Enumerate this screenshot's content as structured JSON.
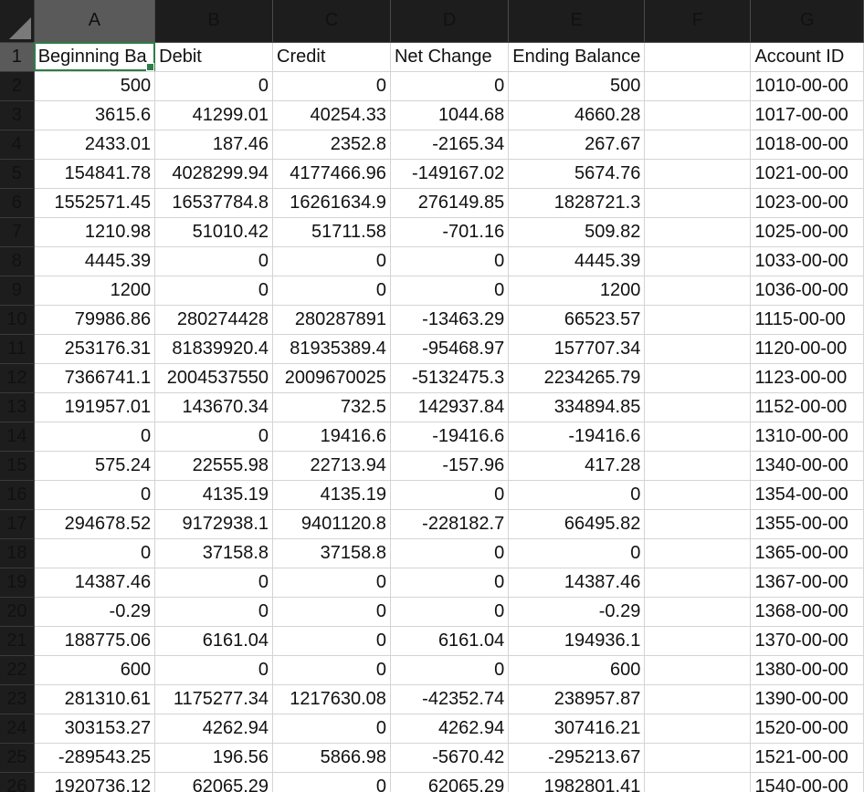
{
  "columns": [
    "A",
    "B",
    "C",
    "D",
    "E",
    "F",
    "G"
  ],
  "header_row": {
    "row_number": "1",
    "cells": [
      "Beginning Ba",
      "Debit",
      "Credit",
      "Net Change",
      "Ending Balance",
      "",
      "Account ID"
    ]
  },
  "rows": [
    {
      "n": "2",
      "cells": [
        "500",
        "0",
        "0",
        "0",
        "500",
        "",
        "1010-00-00"
      ]
    },
    {
      "n": "3",
      "cells": [
        "3615.6",
        "41299.01",
        "40254.33",
        "1044.68",
        "4660.28",
        "",
        "1017-00-00"
      ]
    },
    {
      "n": "4",
      "cells": [
        "2433.01",
        "187.46",
        "2352.8",
        "-2165.34",
        "267.67",
        "",
        "1018-00-00"
      ]
    },
    {
      "n": "5",
      "cells": [
        "154841.78",
        "4028299.94",
        "4177466.96",
        "-149167.02",
        "5674.76",
        "",
        "1021-00-00"
      ]
    },
    {
      "n": "6",
      "cells": [
        "1552571.45",
        "16537784.8",
        "16261634.9",
        "276149.85",
        "1828721.3",
        "",
        "1023-00-00"
      ]
    },
    {
      "n": "7",
      "cells": [
        "1210.98",
        "51010.42",
        "51711.58",
        "-701.16",
        "509.82",
        "",
        "1025-00-00"
      ]
    },
    {
      "n": "8",
      "cells": [
        "4445.39",
        "0",
        "0",
        "0",
        "4445.39",
        "",
        "1033-00-00"
      ]
    },
    {
      "n": "9",
      "cells": [
        "1200",
        "0",
        "0",
        "0",
        "1200",
        "",
        "1036-00-00"
      ]
    },
    {
      "n": "10",
      "cells": [
        "79986.86",
        "280274428",
        "280287891",
        "-13463.29",
        "66523.57",
        "",
        "1115-00-00"
      ]
    },
    {
      "n": "11",
      "cells": [
        "253176.31",
        "81839920.4",
        "81935389.4",
        "-95468.97",
        "157707.34",
        "",
        "1120-00-00"
      ]
    },
    {
      "n": "12",
      "cells": [
        "7366741.1",
        "2004537550",
        "2009670025",
        "-5132475.3",
        "2234265.79",
        "",
        "1123-00-00"
      ]
    },
    {
      "n": "13",
      "cells": [
        "191957.01",
        "143670.34",
        "732.5",
        "142937.84",
        "334894.85",
        "",
        "1152-00-00"
      ]
    },
    {
      "n": "14",
      "cells": [
        "0",
        "0",
        "19416.6",
        "-19416.6",
        "-19416.6",
        "",
        "1310-00-00"
      ]
    },
    {
      "n": "15",
      "cells": [
        "575.24",
        "22555.98",
        "22713.94",
        "-157.96",
        "417.28",
        "",
        "1340-00-00"
      ]
    },
    {
      "n": "16",
      "cells": [
        "0",
        "4135.19",
        "4135.19",
        "0",
        "0",
        "",
        "1354-00-00"
      ]
    },
    {
      "n": "17",
      "cells": [
        "294678.52",
        "9172938.1",
        "9401120.8",
        "-228182.7",
        "66495.82",
        "",
        "1355-00-00"
      ]
    },
    {
      "n": "18",
      "cells": [
        "0",
        "37158.8",
        "37158.8",
        "0",
        "0",
        "",
        "1365-00-00"
      ]
    },
    {
      "n": "19",
      "cells": [
        "14387.46",
        "0",
        "0",
        "0",
        "14387.46",
        "",
        "1367-00-00"
      ]
    },
    {
      "n": "20",
      "cells": [
        "-0.29",
        "0",
        "0",
        "0",
        "-0.29",
        "",
        "1368-00-00"
      ]
    },
    {
      "n": "21",
      "cells": [
        "188775.06",
        "6161.04",
        "0",
        "6161.04",
        "194936.1",
        "",
        "1370-00-00"
      ]
    },
    {
      "n": "22",
      "cells": [
        "600",
        "0",
        "0",
        "0",
        "600",
        "",
        "1380-00-00"
      ]
    },
    {
      "n": "23",
      "cells": [
        "281310.61",
        "1175277.34",
        "1217630.08",
        "-42352.74",
        "238957.87",
        "",
        "1390-00-00"
      ]
    },
    {
      "n": "24",
      "cells": [
        "303153.27",
        "4262.94",
        "0",
        "4262.94",
        "307416.21",
        "",
        "1520-00-00"
      ]
    },
    {
      "n": "25",
      "cells": [
        "-289543.25",
        "196.56",
        "5866.98",
        "-5670.42",
        "-295213.67",
        "",
        "1521-00-00"
      ]
    },
    {
      "n": "26",
      "cells": [
        "1920736.12",
        "62065.29",
        "0",
        "62065.29",
        "1982801.41",
        "",
        "1540-00-00"
      ]
    }
  ],
  "selection": {
    "active_cell": "A1",
    "selected_column": "A",
    "selected_row": "1"
  },
  "colors": {
    "header_bg": "#1d1d1d",
    "header_selected_bg": "#5a5a5a",
    "active_cell_border": "#2e7d48",
    "gridline": "#d4d4d4"
  }
}
